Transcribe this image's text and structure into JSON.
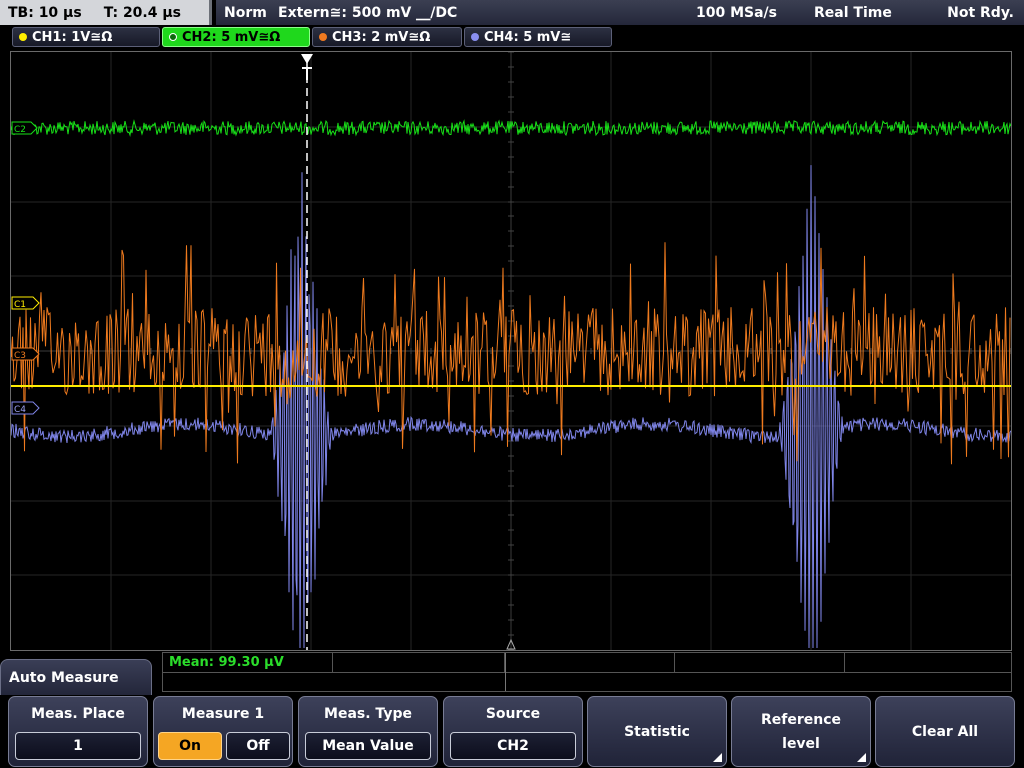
{
  "status": {
    "timebase": "TB: 10 µs",
    "trigger_time": "T: 20.4 µs",
    "trigger_mode": "Norm",
    "trigger_source": "Extern≅: 500 mV ⎽/DC",
    "sample_rate": "100 MSa/s",
    "acquisition_mode": "Real Time",
    "run_state": "Not Rdy."
  },
  "channels": [
    {
      "label": "CH1: 1V≅Ω",
      "color": "#ffee00",
      "active": false
    },
    {
      "label": "CH2: 5 mV≅Ω",
      "color": "#1fd81c",
      "active": true
    },
    {
      "label": "CH3: 2 mV≅Ω",
      "color": "#f07a20",
      "active": false
    },
    {
      "label": "CH4: 5 mV≅",
      "color": "#8a8ff0",
      "active": false
    }
  ],
  "markers": {
    "c2": "C2",
    "c1": "C1",
    "c3": "C3",
    "c4": "C4"
  },
  "measurement": {
    "result": "Mean: 99.30 µV"
  },
  "menu": {
    "title": "Auto Measure",
    "meas_place_label": "Meas. Place",
    "meas_place_value": "1",
    "measure_label": "Measure 1",
    "on_label": "On",
    "off_label": "Off",
    "meas_type_label": "Meas. Type",
    "meas_type_value": "Mean Value",
    "source_label": "Source",
    "source_value": "CH2",
    "statistic_label": "Statistic",
    "reference_label": "Reference level",
    "clear_label": "Clear All"
  }
}
